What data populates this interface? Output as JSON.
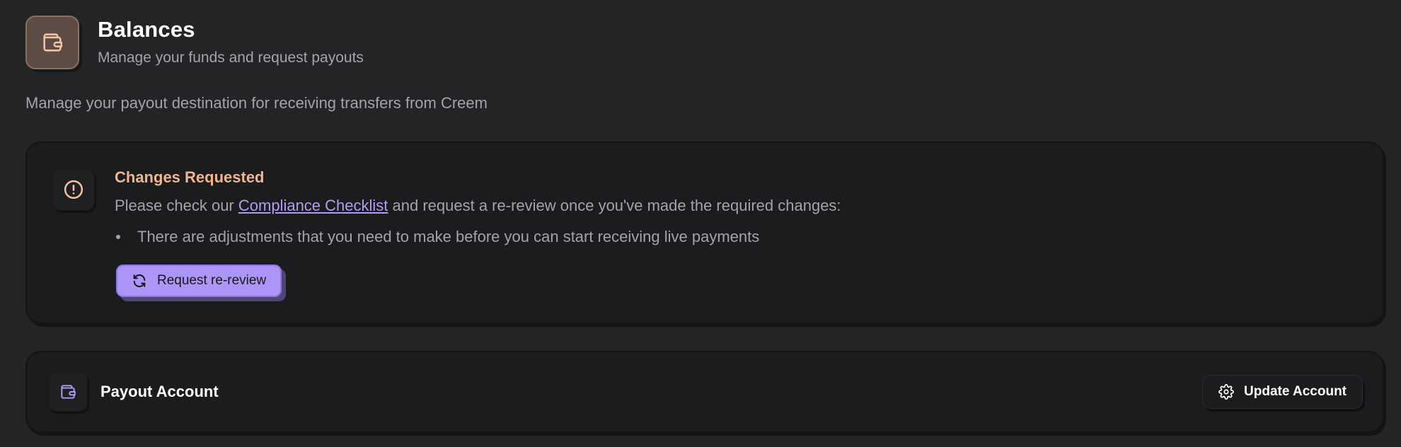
{
  "header": {
    "title": "Balances",
    "subtitle": "Manage your funds and request payouts",
    "icon": "wallet-icon",
    "icon_color": "#f3c2a4"
  },
  "description": "Manage your payout destination for receiving transfers from Creem",
  "review_card": {
    "icon": "alert-circle-icon",
    "title": "Changes Requested",
    "title_color": "#f0b48f",
    "text_before_link": "Please check our ",
    "link_text": "Compliance Checklist",
    "text_after_link": " and request a re-review once you've made the required changes:",
    "bullets": [
      "There are adjustments that you need to make before you can start receiving live payments"
    ],
    "button_label": "Request re-review",
    "button_icon": "refresh-icon",
    "button_color": "#ac95f6"
  },
  "payout_card": {
    "icon": "wallet-icon",
    "icon_color": "#b39bf5",
    "title": "Payout Account",
    "button_label": "Update Account",
    "button_icon": "gear-icon"
  }
}
